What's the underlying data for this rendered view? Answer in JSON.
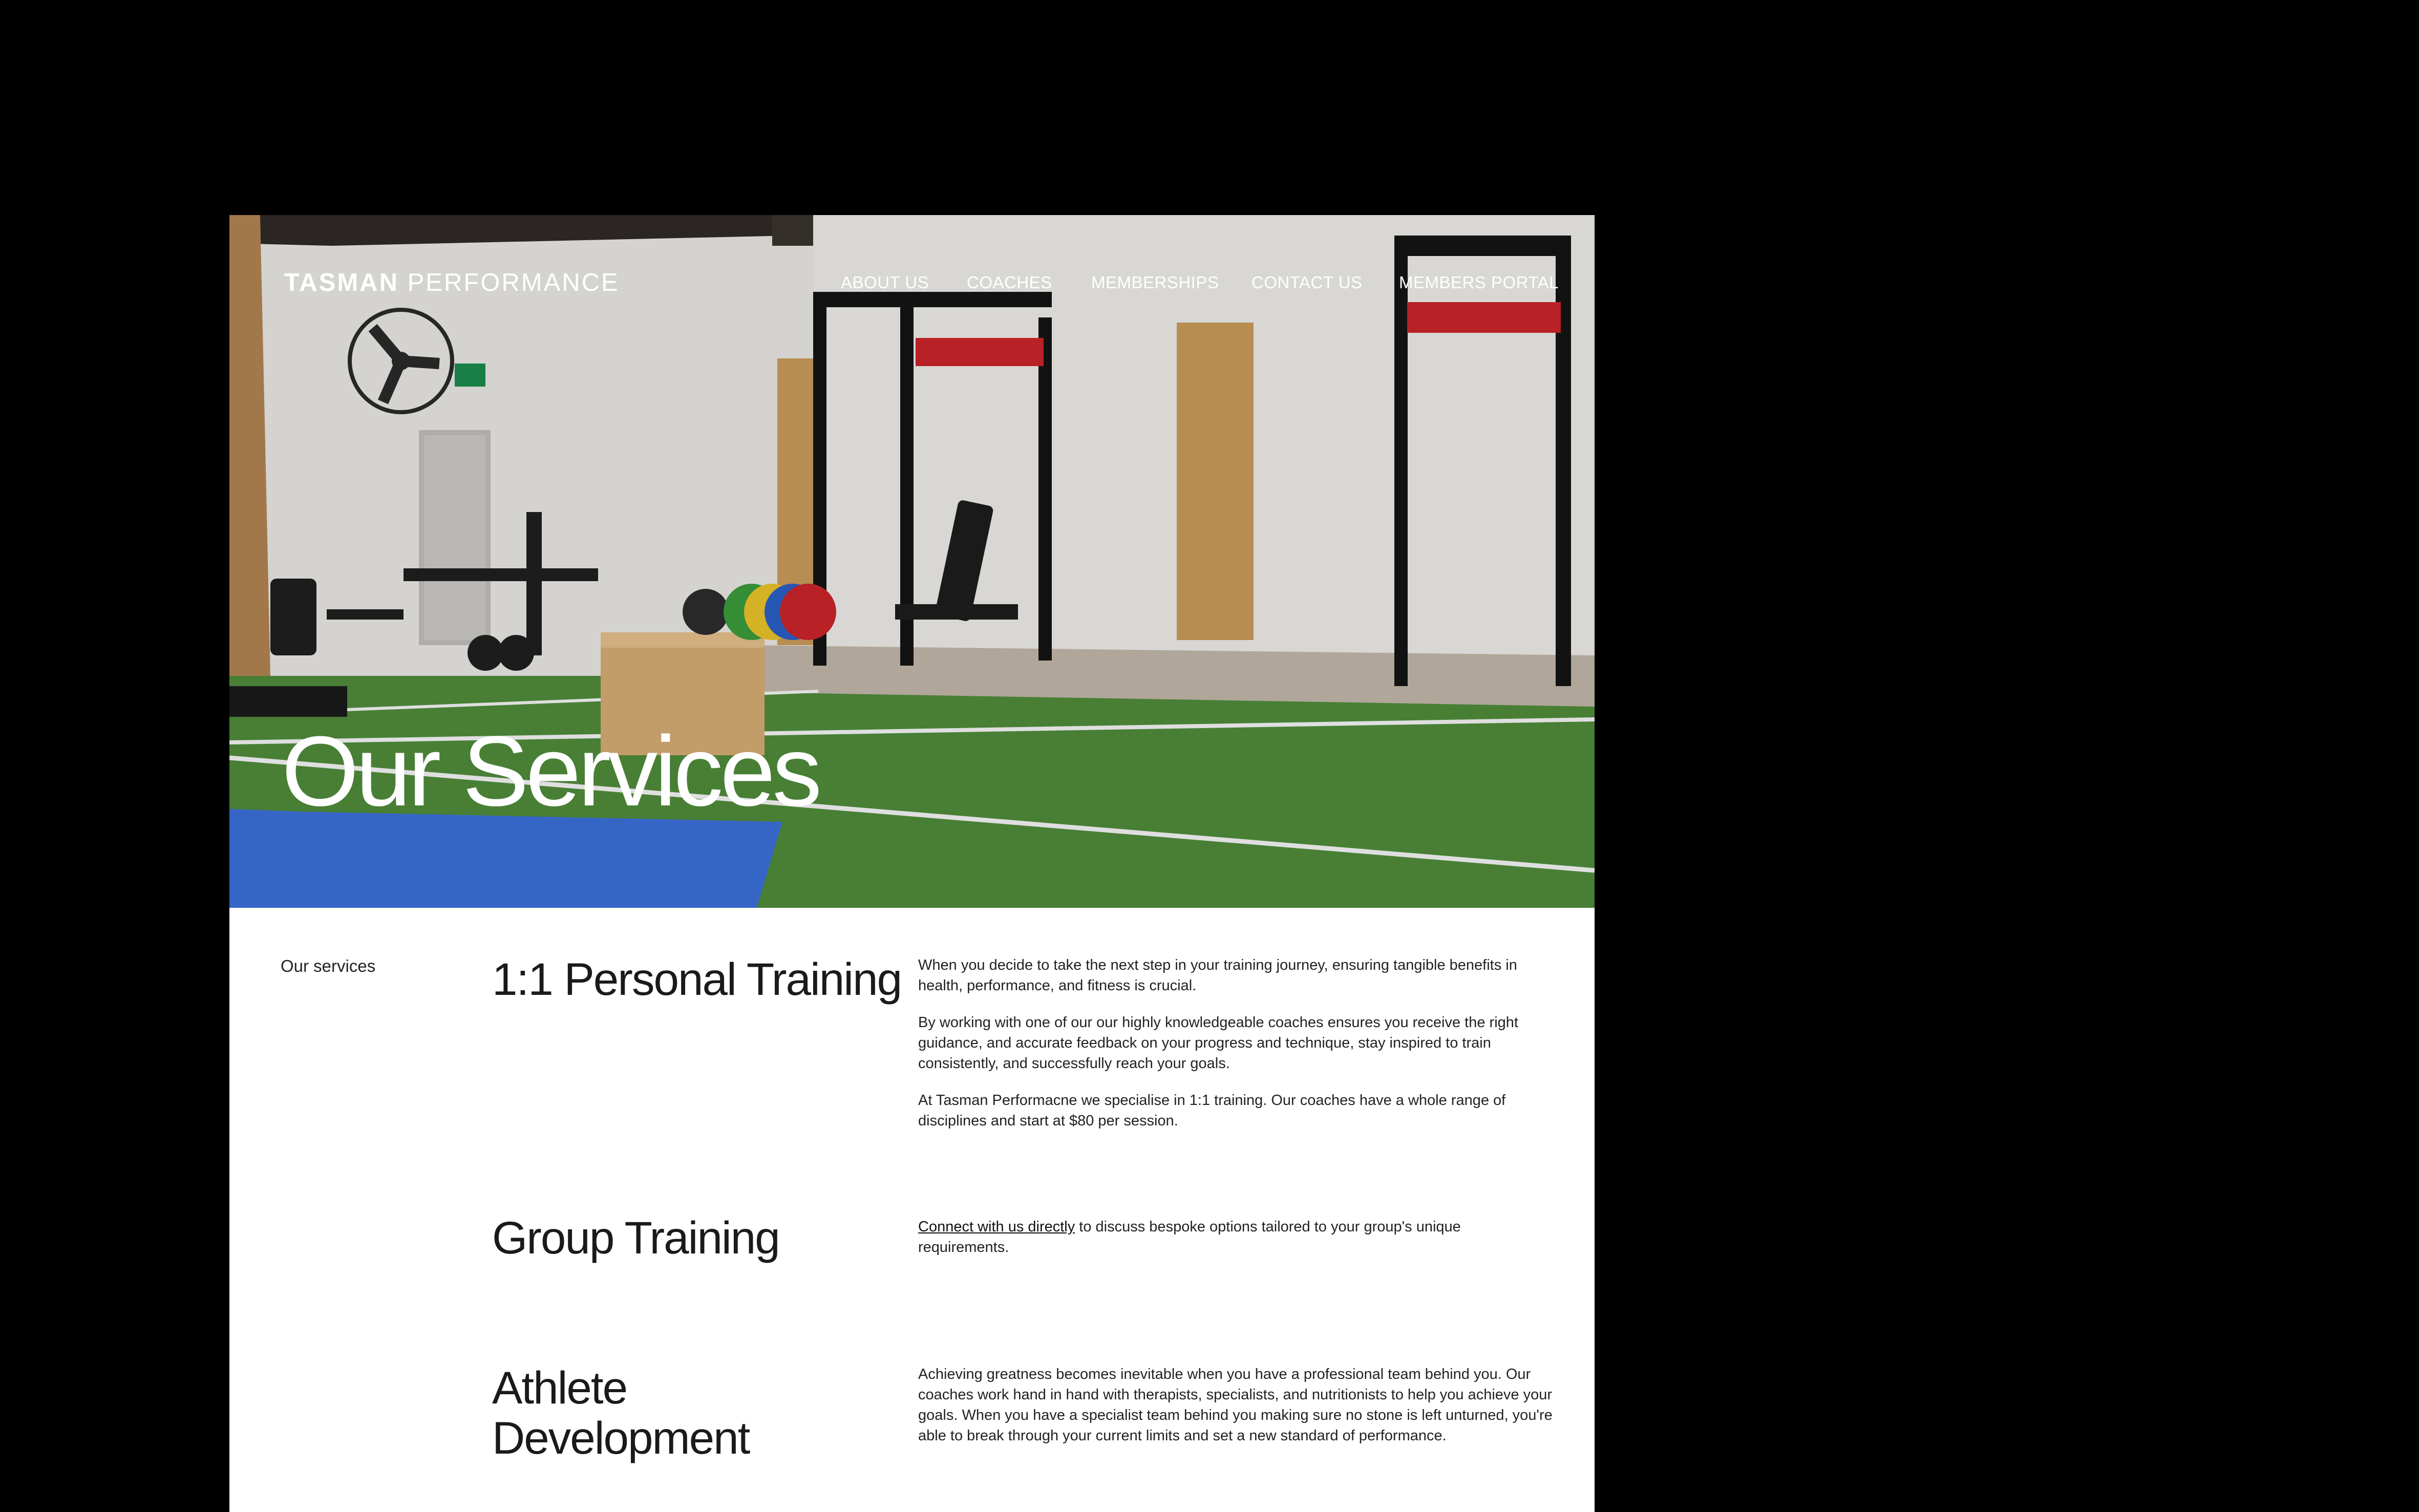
{
  "brand": {
    "name_bold": "TASMAN",
    "name_light": "PERFORMANCE"
  },
  "nav": {
    "about": "ABOUT US",
    "coaches": "COACHES",
    "memberships": "MEMBERSHIPS",
    "contact": "CONTACT US",
    "portal": "MEMBERS PORTAL"
  },
  "hero": {
    "title": "Our Services"
  },
  "content": {
    "section_label": "Our services",
    "services": [
      {
        "title": "1:1 Personal Training",
        "paragraphs": [
          "When you decide to take the next step in your training journey, ensuring tangible benefits in health, performance, and fitness is crucial.",
          "By working with one of our our highly knowledgeable coaches ensures you receive the right guidance, and accurate feedback on your progress and technique, stay inspired to train consistently, and successfully reach your goals.",
          "At Tasman Performacne we specialise in 1:1 training. Our coaches have a whole range of disciplines and start at $80 per session."
        ]
      },
      {
        "title": "Group Training",
        "link_text": "Connect with us directly",
        "after_link": " to discuss bespoke options tailored to your group's unique requirements."
      },
      {
        "title": "Athlete Development",
        "paragraphs": [
          "Achieving greatness becomes inevitable when you have a professional team behind you. Our coaches work hand in hand with therapists, specialists, and nutritionists to help you achieve your goals. When you have a specialist team behind you making sure no stone is left unturned, you're able to break through your current limits and set a new standard of performance."
        ]
      }
    ]
  },
  "colors": {
    "page_background": "#000000",
    "content_background": "#ffffff",
    "turf": "#4f8a3a",
    "mat": "#3b6fd6",
    "rig_accent": "#c8242a",
    "text_dark": "#1a1a1a"
  }
}
